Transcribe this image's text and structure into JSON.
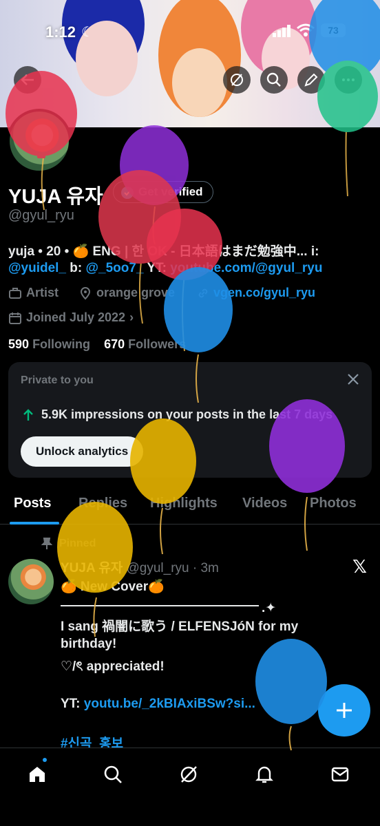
{
  "status": {
    "time": "1:12",
    "battery": "73"
  },
  "profile": {
    "name": "YUJA 유자",
    "verify_label": "Get verified",
    "handle": "@gyul_ryu",
    "bio_line1": "yuja • 20 • 🍊 ENG | 한 OK - 日本語はまだ勉強中... i:",
    "bio_line2_a": "@yuidel_",
    "bio_line2_b": " b: ",
    "bio_line2_c": "@_5oo7_",
    "bio_line2_d": " YT: ",
    "bio_line2_e": "youtube.com/@gyul_ryu",
    "category": "Artist",
    "location": "orange grove",
    "website": "vgen.co/gyul_ryu",
    "joined": "Joined July 2022",
    "following_count": "590",
    "following_label": "Following",
    "followers_count": "670",
    "followers_label": "Followers"
  },
  "private_card": {
    "title": "Private to you",
    "impressions": "5.9K impressions on your posts in the last 7 days",
    "button": "Unlock analytics"
  },
  "tabs": [
    "Posts",
    "Replies",
    "Highlights",
    "Videos",
    "Photos"
  ],
  "post": {
    "pinned": "Pinned",
    "author": "YUJA 유자",
    "meta": "@gyul_ryu · 3m",
    "line1": "🍊 New Cover🍊",
    "line2": "I sang  禍闇に歌う / ELFENSJóN  for my",
    "line3": "birthday!",
    "line4": "♡/ৎ appreciated!",
    "line5_label": "YT: ",
    "line5_link": "youtu.be/_2kBIAxiBSw?si...",
    "hashtag": "#신곡_홍보"
  },
  "icons": {
    "header": [
      "grok-icon",
      "search-icon",
      "edit-icon",
      "more-icon"
    ],
    "nav": [
      "home-icon",
      "search-icon",
      "grok-icon",
      "notifications-icon",
      "messages-icon"
    ],
    "fab": "plus-icon"
  },
  "colors": {
    "accent": "#1d9bf0",
    "balloons": [
      "#e8334f",
      "#8e2fd8",
      "#e0384e",
      "#1f8ee6",
      "#e7b400",
      "#21c28a"
    ]
  }
}
